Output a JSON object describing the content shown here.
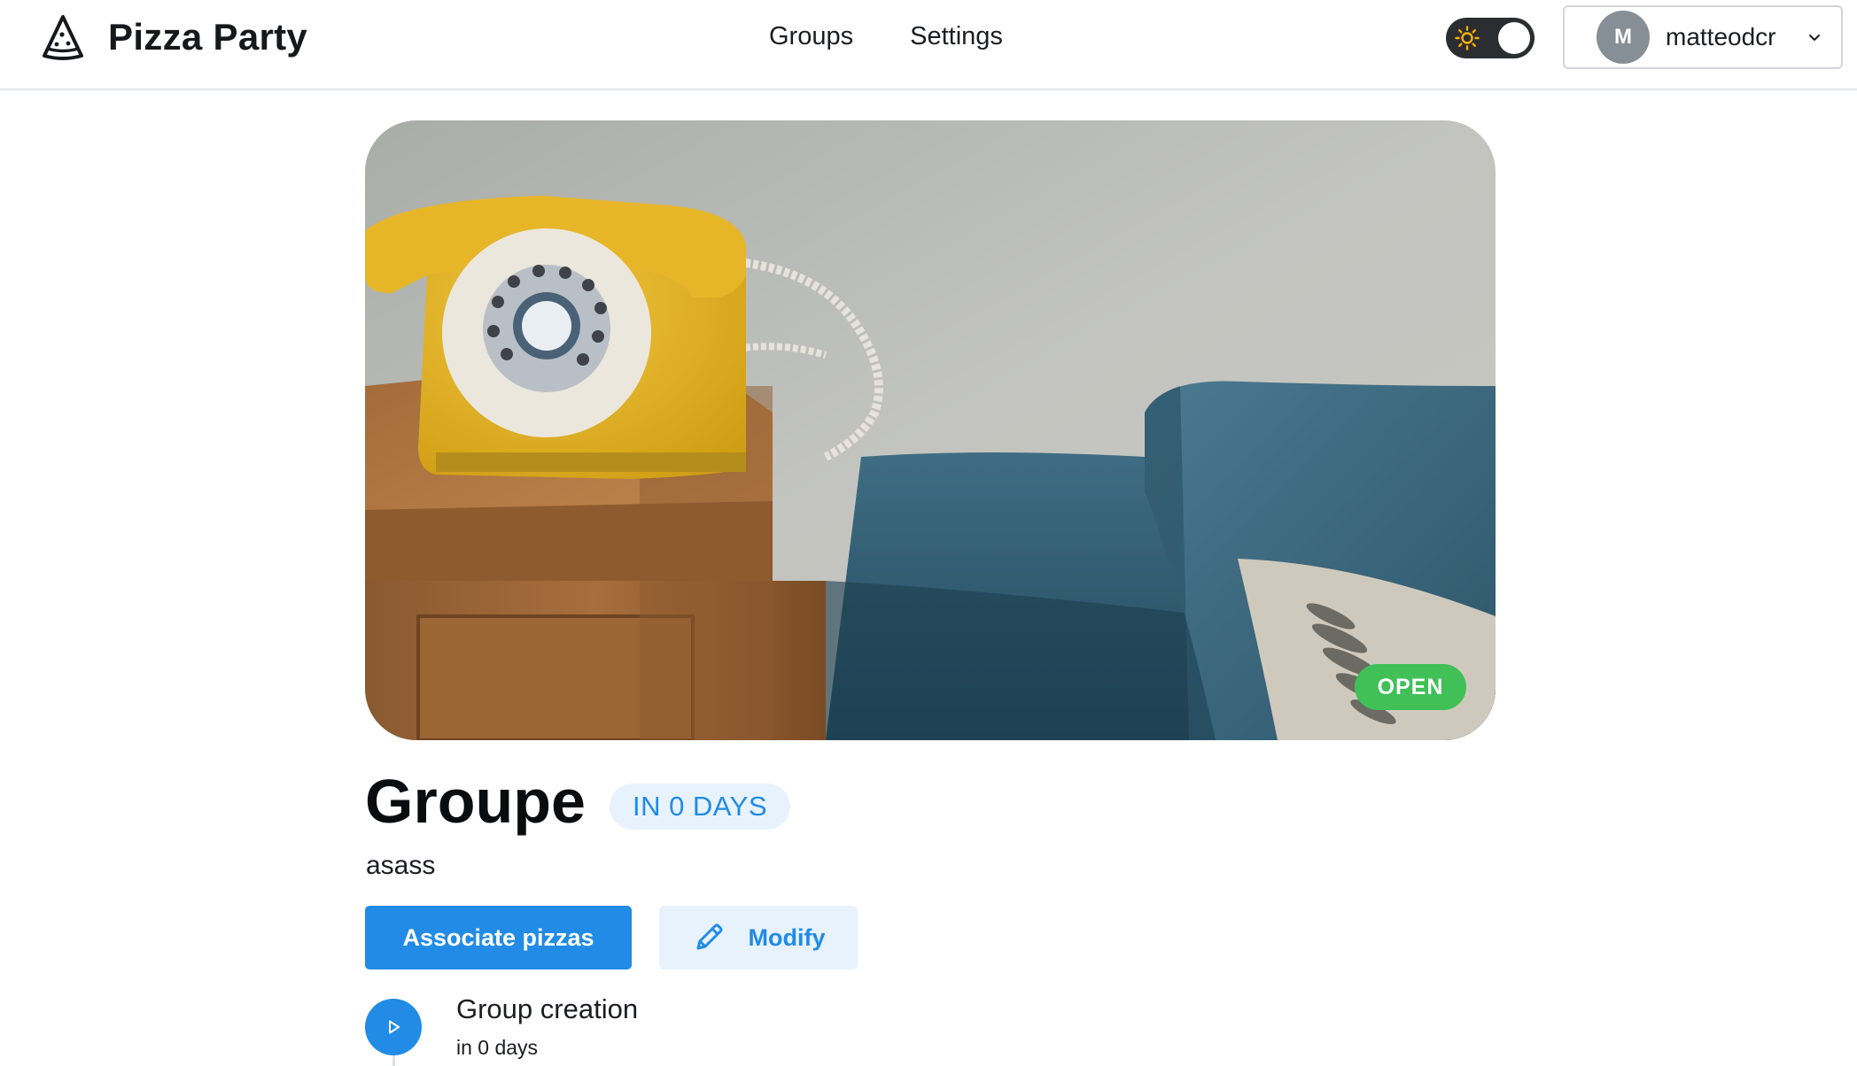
{
  "app": {
    "title": "Pizza Party",
    "logo_icon": "pizza-slice-icon"
  },
  "nav": {
    "items": [
      {
        "label": "Groups"
      },
      {
        "label": "Settings"
      }
    ]
  },
  "theme_toggle": {
    "icon": "sun-icon",
    "state": "dark"
  },
  "user": {
    "initial": "M",
    "name": "matteodcr",
    "menu_icon": "chevron-down-icon"
  },
  "group": {
    "status": "OPEN",
    "title": "Groupe",
    "date_badge": "IN 0 DAYS",
    "description": "asass",
    "buttons": {
      "associate": "Associate pizzas",
      "modify": "Modify"
    },
    "timeline": [
      {
        "title": "Group creation",
        "subtitle": "in 0 days",
        "icon": "play-icon"
      }
    ]
  },
  "colors": {
    "primary": "#228be6",
    "primary_light": "#e7f2fd",
    "open_green": "#40c057",
    "avatar_gray": "#868e96",
    "toggle_dark": "#2b2d31",
    "sun_yellow": "#fab005"
  }
}
